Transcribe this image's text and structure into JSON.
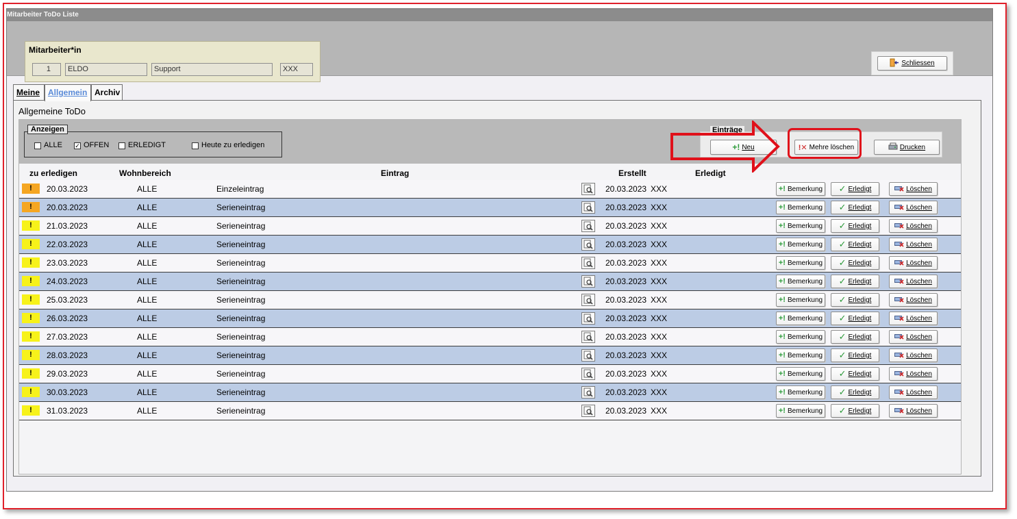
{
  "window": {
    "title": "Mitarbeiter ToDo Liste"
  },
  "employee": {
    "label": "Mitarbeiter*in",
    "id": "1",
    "name": "ELDO",
    "department": "Support",
    "code": "XXX"
  },
  "close_button": {
    "label": "Schliessen"
  },
  "tabs": [
    {
      "label": "Meine",
      "active": false
    },
    {
      "label": "Allgemein",
      "active": true
    },
    {
      "label": "Archiv",
      "active": false
    }
  ],
  "panel": {
    "title": "Allgemeine ToDo"
  },
  "filter": {
    "legend": "Anzeigen",
    "options": [
      {
        "label": "ALLE",
        "checked": false
      },
      {
        "label": "OFFEN",
        "checked": true
      },
      {
        "label": "ERLEDIGT",
        "checked": false
      },
      {
        "label": "Heute zu erledigen",
        "checked": false
      }
    ]
  },
  "entries_group": {
    "legend": "Einträge",
    "new_label": "Neu",
    "delete_multiple_label": "Mehre löschen",
    "print_label": "Drucken"
  },
  "columns": {
    "due": "zu erledigen",
    "area": "Wohnbereich",
    "entry": "Eintrag",
    "created": "Erstellt",
    "done": "Erledigt"
  },
  "row_buttons": {
    "remark": "Bemerkung",
    "done": "Erledigt",
    "delete": "Löschen"
  },
  "colors": {
    "prio_orange": "#f5a623",
    "prio_yellow": "#f7f21a",
    "annotation_red": "#e0101a",
    "row_blue": "#bccce5"
  },
  "rows": [
    {
      "priority_mark": "!",
      "prio_color": "orange",
      "due": "20.03.2023",
      "area": "ALLE",
      "entry": "Einzeleintrag",
      "created": "20.03.2023",
      "created_by": "XXX"
    },
    {
      "priority_mark": "!",
      "prio_color": "orange",
      "due": "20.03.2023",
      "area": "ALLE",
      "entry": "Serieneintrag",
      "created": "20.03.2023",
      "created_by": "XXX"
    },
    {
      "priority_mark": "!",
      "prio_color": "yellow",
      "due": "21.03.2023",
      "area": "ALLE",
      "entry": "Serieneintrag",
      "created": "20.03.2023",
      "created_by": "XXX"
    },
    {
      "priority_mark": "!",
      "prio_color": "yellow",
      "due": "22.03.2023",
      "area": "ALLE",
      "entry": "Serieneintrag",
      "created": "20.03.2023",
      "created_by": "XXX"
    },
    {
      "priority_mark": "!",
      "prio_color": "yellow",
      "due": "23.03.2023",
      "area": "ALLE",
      "entry": "Serieneintrag",
      "created": "20.03.2023",
      "created_by": "XXX"
    },
    {
      "priority_mark": "!",
      "prio_color": "yellow",
      "due": "24.03.2023",
      "area": "ALLE",
      "entry": "Serieneintrag",
      "created": "20.03.2023",
      "created_by": "XXX"
    },
    {
      "priority_mark": "!",
      "prio_color": "yellow",
      "due": "25.03.2023",
      "area": "ALLE",
      "entry": "Serieneintrag",
      "created": "20.03.2023",
      "created_by": "XXX"
    },
    {
      "priority_mark": "!",
      "prio_color": "yellow",
      "due": "26.03.2023",
      "area": "ALLE",
      "entry": "Serieneintrag",
      "created": "20.03.2023",
      "created_by": "XXX"
    },
    {
      "priority_mark": "!",
      "prio_color": "yellow",
      "due": "27.03.2023",
      "area": "ALLE",
      "entry": "Serieneintrag",
      "created": "20.03.2023",
      "created_by": "XXX"
    },
    {
      "priority_mark": "!",
      "prio_color": "yellow",
      "due": "28.03.2023",
      "area": "ALLE",
      "entry": "Serieneintrag",
      "created": "20.03.2023",
      "created_by": "XXX"
    },
    {
      "priority_mark": "!",
      "prio_color": "yellow",
      "due": "29.03.2023",
      "area": "ALLE",
      "entry": "Serieneintrag",
      "created": "20.03.2023",
      "created_by": "XXX"
    },
    {
      "priority_mark": "!",
      "prio_color": "yellow",
      "due": "30.03.2023",
      "area": "ALLE",
      "entry": "Serieneintrag",
      "created": "20.03.2023",
      "created_by": "XXX"
    },
    {
      "priority_mark": "!",
      "prio_color": "yellow",
      "due": "31.03.2023",
      "area": "ALLE",
      "entry": "Serieneintrag",
      "created": "20.03.2023",
      "created_by": "XXX"
    }
  ]
}
